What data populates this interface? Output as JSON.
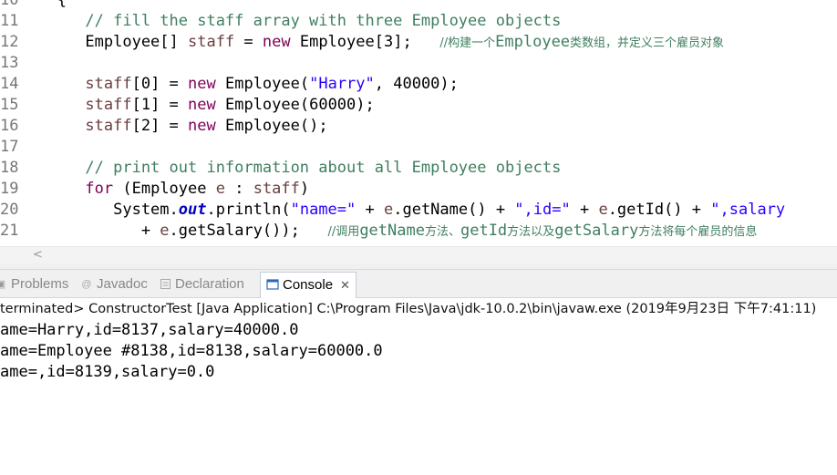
{
  "editor": {
    "lines": [
      {
        "no": "10",
        "parts": [
          {
            "t": "   {",
            "c": ""
          }
        ]
      },
      {
        "no": "11",
        "parts": [
          {
            "t": "      // fill the staff array with three Employee objects",
            "c": "cm"
          }
        ]
      },
      {
        "no": "12",
        "parts": [
          {
            "t": "      Employee[] ",
            "c": ""
          },
          {
            "t": "staff",
            "c": "var"
          },
          {
            "t": " = ",
            "c": ""
          },
          {
            "t": "new",
            "c": "kw"
          },
          {
            "t": " Employee[3];   ",
            "c": ""
          },
          {
            "t": "//构建一个",
            "c": "cm zh"
          },
          {
            "t": "Employee",
            "c": "cm"
          },
          {
            "t": "类数组，并定义三个雇员对象",
            "c": "cm zh"
          }
        ]
      },
      {
        "no": "13",
        "parts": [
          {
            "t": "",
            "c": ""
          }
        ]
      },
      {
        "no": "14",
        "parts": [
          {
            "t": "      ",
            "c": ""
          },
          {
            "t": "staff",
            "c": "var"
          },
          {
            "t": "[0] = ",
            "c": ""
          },
          {
            "t": "new",
            "c": "kw"
          },
          {
            "t": " Employee(",
            "c": ""
          },
          {
            "t": "\"Harry\"",
            "c": "st"
          },
          {
            "t": ", 40000);",
            "c": ""
          }
        ]
      },
      {
        "no": "15",
        "parts": [
          {
            "t": "      ",
            "c": ""
          },
          {
            "t": "staff",
            "c": "var"
          },
          {
            "t": "[1] = ",
            "c": ""
          },
          {
            "t": "new",
            "c": "kw"
          },
          {
            "t": " Employee(60000);",
            "c": ""
          }
        ]
      },
      {
        "no": "16",
        "parts": [
          {
            "t": "      ",
            "c": ""
          },
          {
            "t": "staff",
            "c": "var"
          },
          {
            "t": "[2] = ",
            "c": ""
          },
          {
            "t": "new",
            "c": "kw"
          },
          {
            "t": " Employee();",
            "c": ""
          }
        ]
      },
      {
        "no": "17",
        "parts": [
          {
            "t": "",
            "c": ""
          }
        ]
      },
      {
        "no": "18",
        "parts": [
          {
            "t": "      // print out information about all Employee objects",
            "c": "cm"
          }
        ]
      },
      {
        "no": "19",
        "parts": [
          {
            "t": "      ",
            "c": ""
          },
          {
            "t": "for",
            "c": "kw"
          },
          {
            "t": " (Employee ",
            "c": ""
          },
          {
            "t": "e",
            "c": "var"
          },
          {
            "t": " : ",
            "c": ""
          },
          {
            "t": "staff",
            "c": "var"
          },
          {
            "t": ")",
            "c": ""
          }
        ]
      },
      {
        "no": "20",
        "parts": [
          {
            "t": "         System.",
            "c": ""
          },
          {
            "t": "out",
            "c": "fi"
          },
          {
            "t": ".println(",
            "c": ""
          },
          {
            "t": "\"name=\"",
            "c": "st"
          },
          {
            "t": " + ",
            "c": ""
          },
          {
            "t": "e",
            "c": "var"
          },
          {
            "t": ".getName() + ",
            "c": ""
          },
          {
            "t": "\",id=\"",
            "c": "st"
          },
          {
            "t": " + ",
            "c": ""
          },
          {
            "t": "e",
            "c": "var"
          },
          {
            "t": ".getId() + ",
            "c": ""
          },
          {
            "t": "\",salary",
            "c": "st"
          }
        ]
      },
      {
        "no": "21",
        "parts": [
          {
            "t": "            + ",
            "c": ""
          },
          {
            "t": "e",
            "c": "var"
          },
          {
            "t": ".getSalary());   ",
            "c": ""
          },
          {
            "t": "//调用",
            "c": "cm zh"
          },
          {
            "t": "getName",
            "c": "cm"
          },
          {
            "t": "方法、",
            "c": "cm zh"
          },
          {
            "t": "getId",
            "c": "cm"
          },
          {
            "t": "方法以及",
            "c": "cm zh"
          },
          {
            "t": "getSalary",
            "c": "cm"
          },
          {
            "t": "方法将每个雇员的信息",
            "c": "cm zh"
          }
        ]
      }
    ]
  },
  "tabs": {
    "problems": "Problems",
    "javadoc": "Javadoc",
    "declaration": "Declaration",
    "console": "Console",
    "close_symbol": "✕",
    "javadoc_icon": "@"
  },
  "console": {
    "status": "terminated> ConstructorTest [Java Application] C:\\Program Files\\Java\\jdk-10.0.2\\bin\\javaw.exe (2019年9月23日 下午7:41:11)",
    "output": [
      "ame=Harry,id=8137,salary=40000.0",
      "ame=Employee #8138,id=8138,salary=60000.0",
      "ame=,id=8139,salary=0.0"
    ]
  },
  "scroll": {
    "left_arrow": "<"
  }
}
